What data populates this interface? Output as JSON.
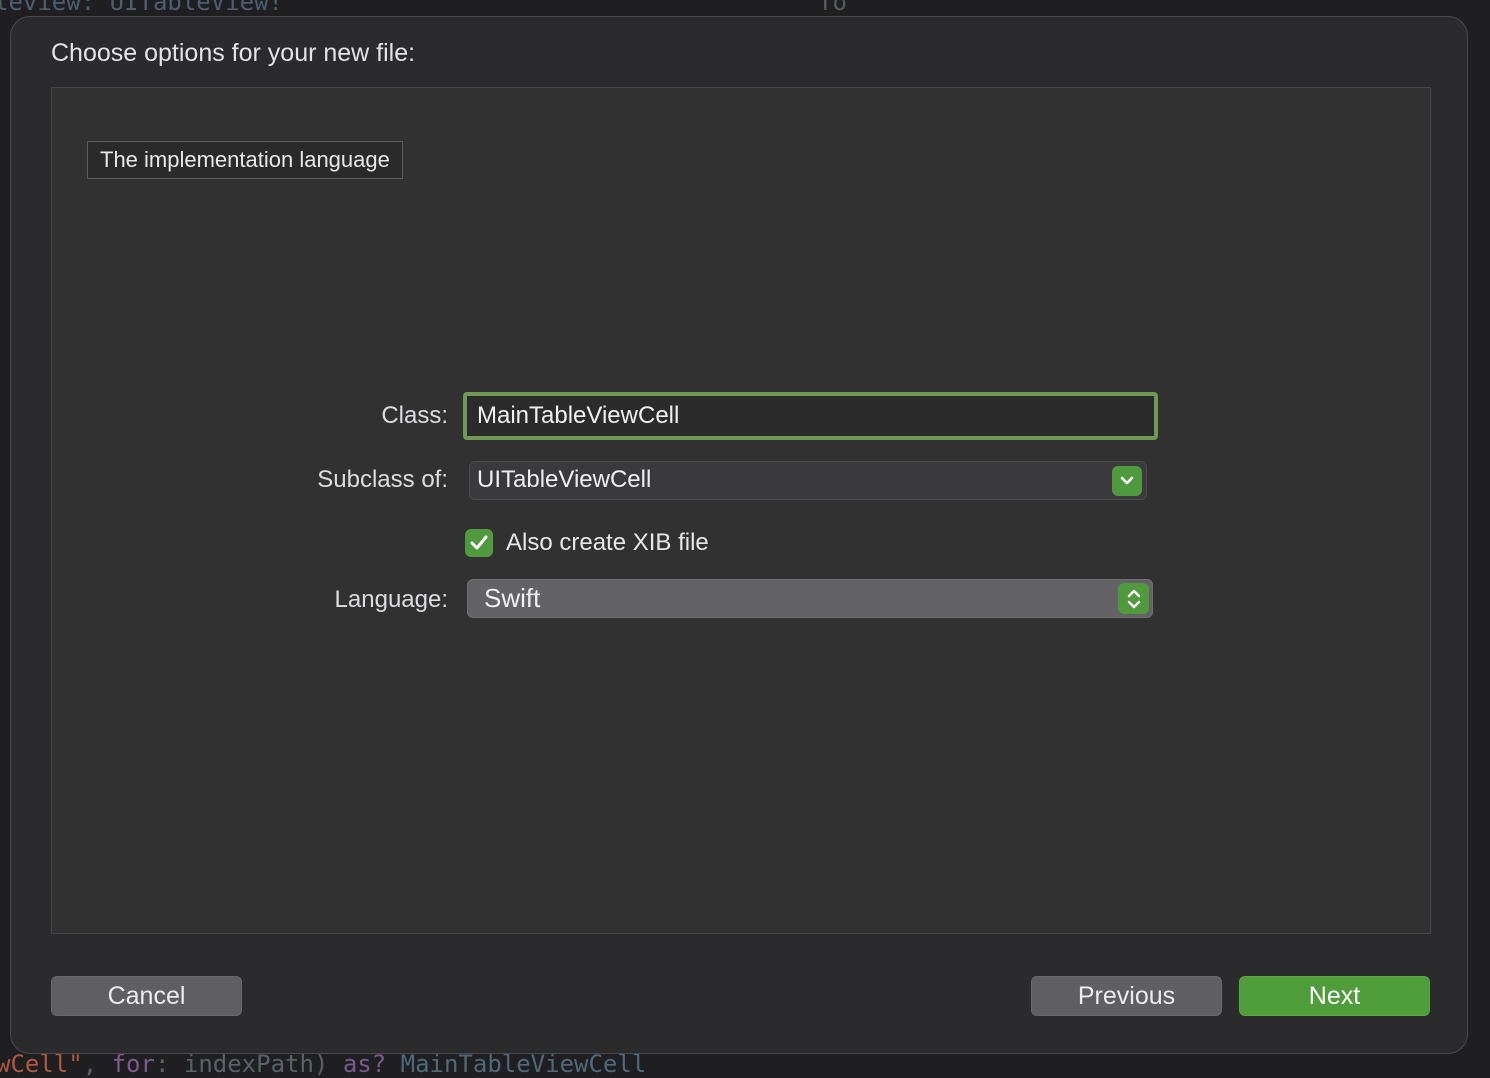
{
  "background": {
    "top_code": "leview: UITableView!",
    "top_code_2": "To",
    "bottom_code": {
      "string": "wCell\"",
      "sep": ", ",
      "kw1": "for",
      "rest": ": indexPath) ",
      "kw2": "as?",
      "type": " MainTableViewCell"
    }
  },
  "sheet": {
    "title": "Choose options for your new file:",
    "tooltip": "The implementation language"
  },
  "form": {
    "class_label": "Class:",
    "class_value": "MainTableViewCell",
    "subclass_label": "Subclass of:",
    "subclass_value": "UITableViewCell",
    "xib_checkbox_label": "Also create XIB file",
    "xib_checked": true,
    "language_label": "Language:",
    "language_value": "Swift"
  },
  "buttons": {
    "cancel": "Cancel",
    "previous": "Previous",
    "next": "Next"
  },
  "colors": {
    "accent": "#4e9d3a",
    "focus_ring": "#6e9a53",
    "sheet_bg": "#2b2b2d"
  },
  "icons": {
    "combo": "chevron-down-icon",
    "popup": "up-down-chevron-icon",
    "checkbox": "checkmark-icon"
  }
}
